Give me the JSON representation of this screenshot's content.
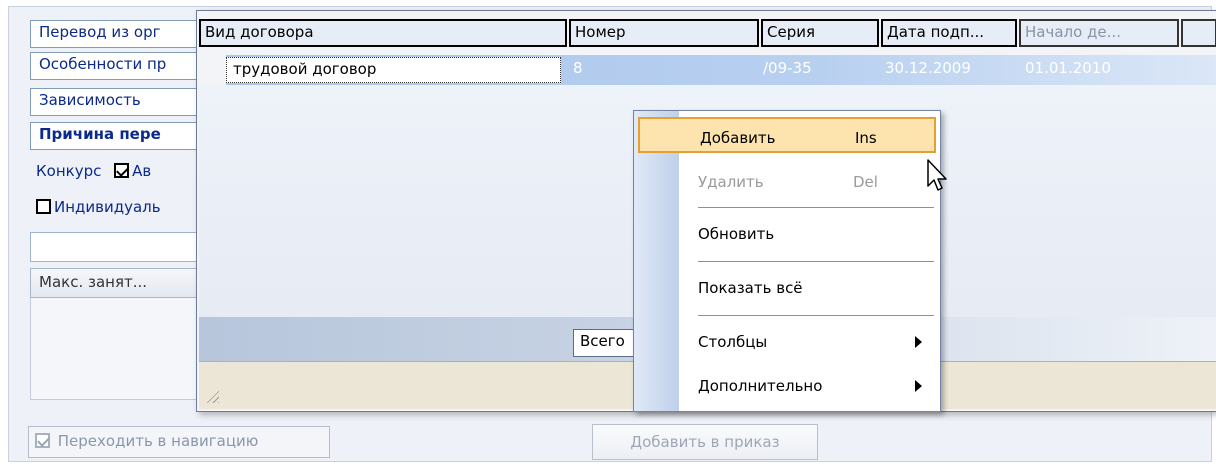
{
  "left_panel": {
    "rows": [
      "Перевод из орг",
      "Особенности пр",
      "Зависимость",
      "Причина пере"
    ],
    "contest_label": "Конкурс",
    "av_label": "Ав",
    "individual_label": "Индивидуаль",
    "column_header": "Макс. занят..."
  },
  "grid": {
    "columns": [
      "Вид договора",
      "Номер",
      "Серия",
      "Дата подп...",
      "Начало де..."
    ],
    "row": {
      "type": "трудовой договор",
      "number": "8",
      "series": "/09-35",
      "sign_date": "30.12.2009",
      "start_date": "01.01.2010"
    },
    "total_label": "Всего"
  },
  "context_menu": {
    "items": [
      {
        "label": "Добавить",
        "shortcut": "Ins"
      },
      {
        "label": "Удалить",
        "shortcut": "Del"
      },
      {
        "label": "Обновить"
      },
      {
        "label": "Показать всё"
      },
      {
        "label": "Столбцы"
      },
      {
        "label": "Дополнительно"
      }
    ]
  },
  "bottom": {
    "navigate_label": "Переходить в навигацию",
    "add_to_order_label": "Добавить в приказ"
  },
  "colors": {
    "selection": "#aac6ec",
    "menu_highlight": "#fde3ad",
    "menu_highlight_border": "#e59f34",
    "link_text": "#0b2a8a"
  },
  "icons": [
    "checkbox-checked-icon",
    "checkbox-unchecked-icon",
    "submenu-arrow-icon",
    "resize-grip-icon",
    "mouse-cursor-icon"
  ]
}
